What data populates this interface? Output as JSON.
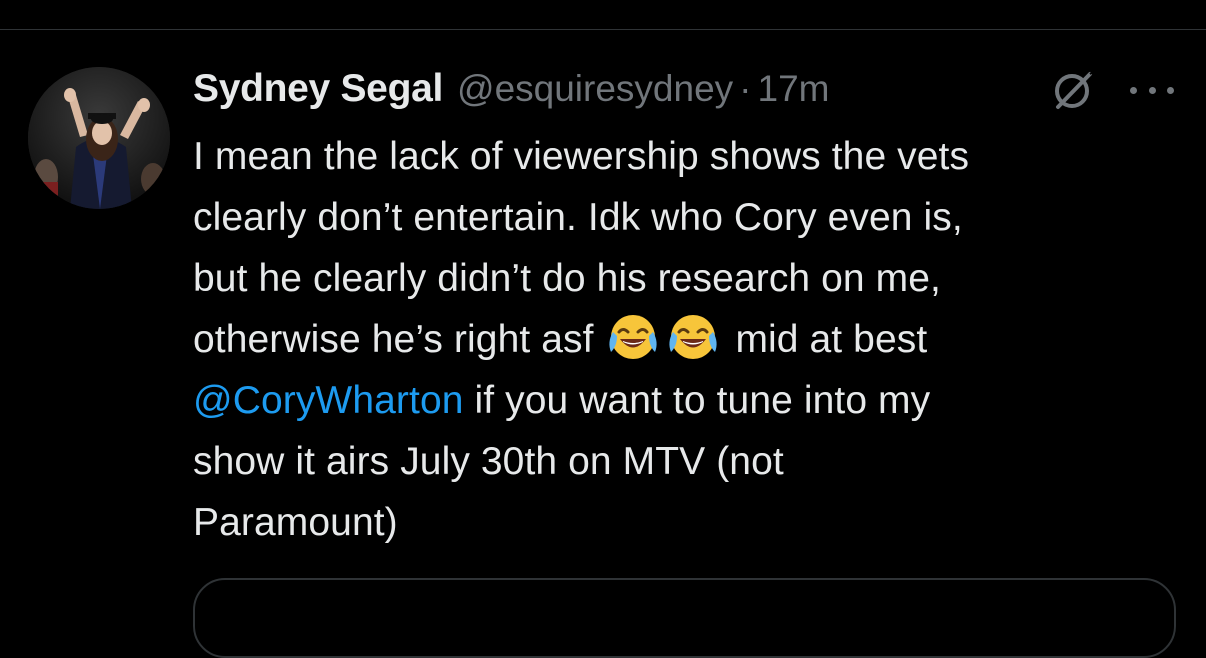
{
  "tweet": {
    "author_name": "Sydney Segal",
    "author_handle": "@esquiresydney",
    "separator": "·",
    "timestamp": "17m",
    "text_lines": [
      "I mean the lack of viewership shows the vets",
      "clearly don’t entertain. Idk who Cory even is,",
      "but he clearly didn’t do his research on me,",
      "otherwise he’s right asf",
      "mid at best",
      "@CoryWharton",
      "if you want to tune into my",
      "show it airs July 30th on MTV (not",
      "Paramount)"
    ],
    "emojis": [
      "face-with-tears-of-joy",
      "face-with-tears-of-joy"
    ],
    "avatar": "graduation-photo-avatar"
  },
  "icons": {
    "grok": "grok-icon",
    "more": "more-options-icon"
  },
  "colors": {
    "background": "#000000",
    "text": "#e7e9ea",
    "secondary": "#71767b",
    "mention": "#1d9bf0",
    "border": "#2f3336"
  }
}
